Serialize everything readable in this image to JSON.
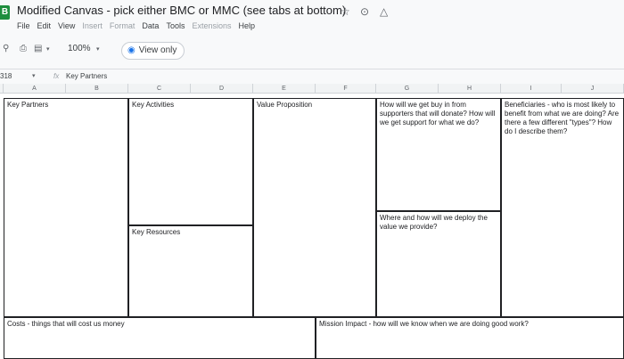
{
  "app": {
    "logo_letter": "B",
    "title": "Modified Canvas - pick either BMC or MMC (see tabs at bottom)",
    "icons": [
      "star-icon",
      "move-to-folder-icon",
      "cloud-status-icon"
    ]
  },
  "menu": [
    "File",
    "Edit",
    "View",
    "Insert",
    "Format",
    "Data",
    "Tools",
    "Extensions",
    "Help"
  ],
  "toolbar": {
    "zoom": "100%",
    "view_only_label": "View only"
  },
  "formula_bar": {
    "name_box": "318",
    "fx": "fx",
    "content": "Key Partners"
  },
  "columns": [
    "A",
    "B",
    "C",
    "D",
    "E",
    "F",
    "G",
    "H",
    "I",
    "J"
  ],
  "cells": {
    "key_partners": "Key Partners",
    "key_activities": "Key Activities",
    "key_resources": "Key Resources",
    "value_proposition": "Value Proposition",
    "buy_in": "How will we get buy in from supporters that will donate? How will we get support for what we do?",
    "beneficiaries": "Beneficiaries - who is most likely to benefit from what we are doing? Are there a few different \"types\"? How do I describe them?",
    "deploy": "Where and how will we deploy the value we provide?",
    "costs": "Costs - things that will cost us money",
    "mission_impact": "Mission Impact - how will we know when we are doing good work?"
  }
}
